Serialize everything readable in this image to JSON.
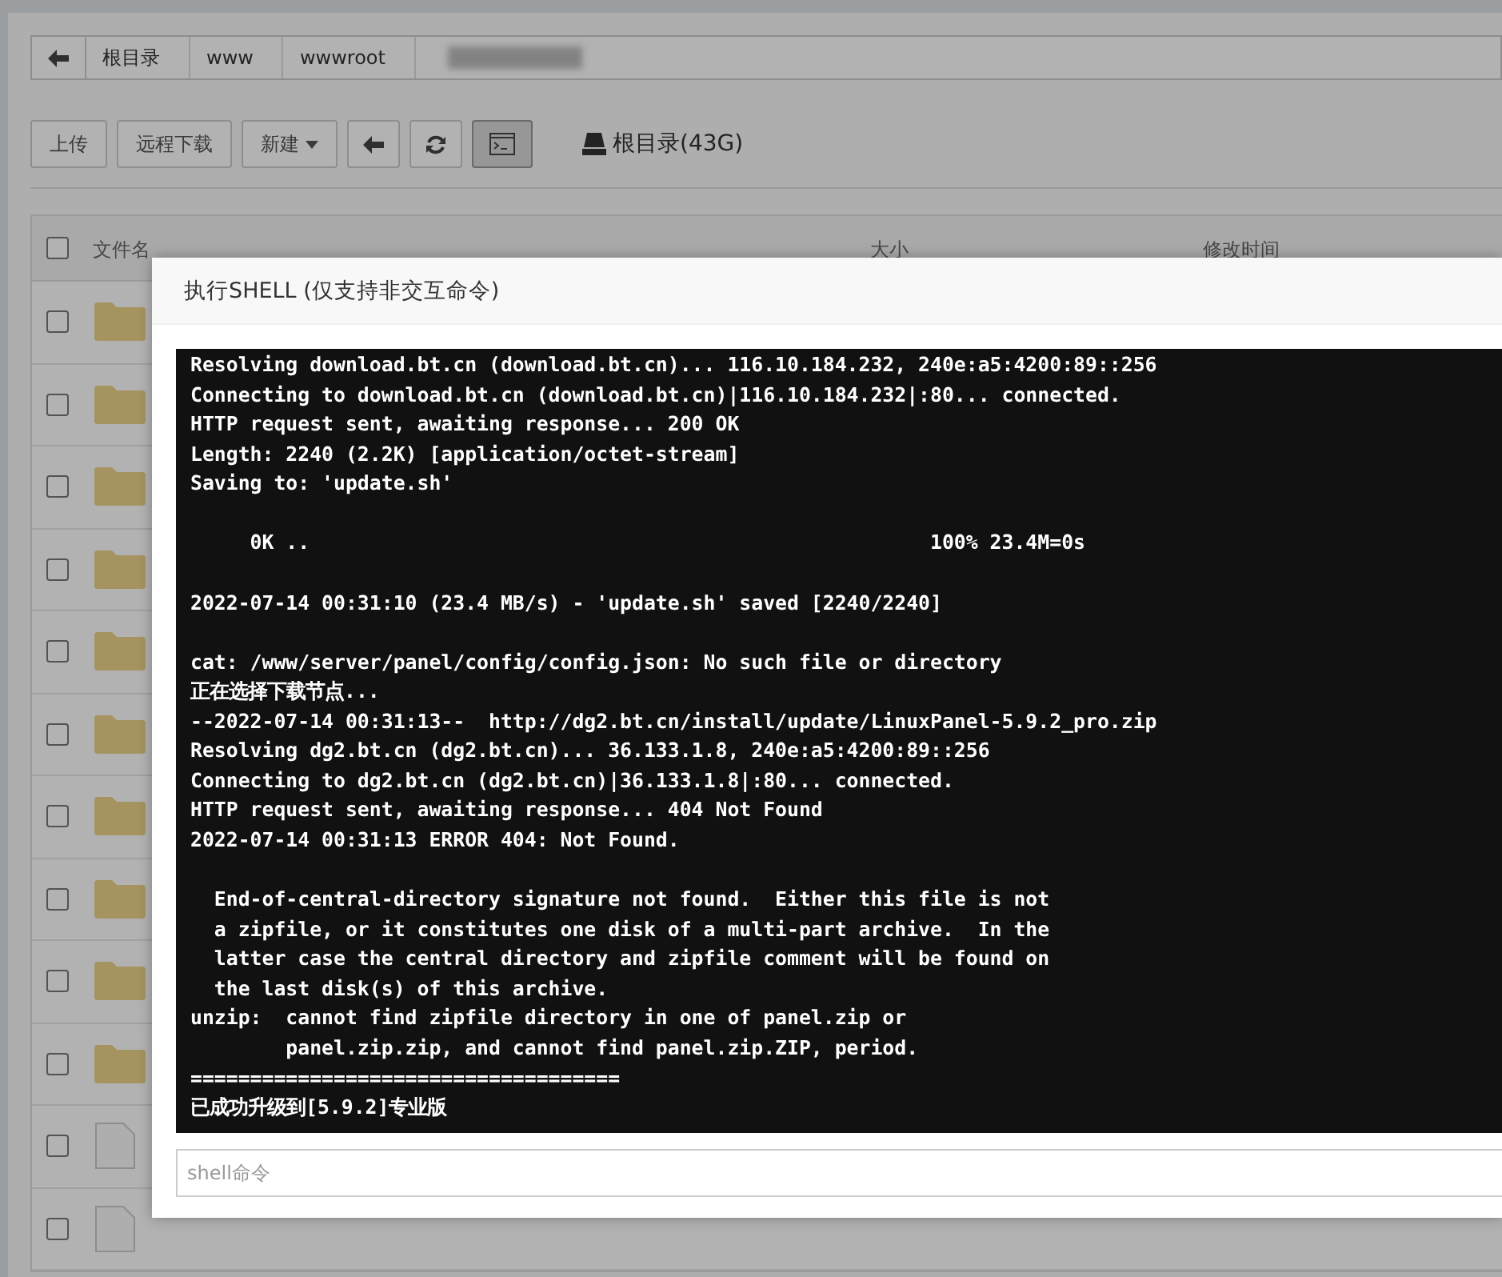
{
  "breadcrumbs": {
    "items": [
      "根目录",
      "www",
      "wwwroot"
    ],
    "has_redacted_item": true
  },
  "toolbar": {
    "buttons": [
      {
        "kind": "text",
        "label": "上传",
        "active": false
      },
      {
        "kind": "dropdown_none",
        "label": "远程下载",
        "active": false
      },
      {
        "kind": "dropdown",
        "label": "新建",
        "active": false
      },
      {
        "kind": "back",
        "active": false
      },
      {
        "kind": "refresh",
        "active": false
      },
      {
        "kind": "terminal",
        "active": true
      }
    ],
    "disk": "根目录(43G)"
  },
  "table": {
    "columns": [
      "文件名",
      "大小",
      "修改时间"
    ],
    "header_checked": false,
    "rows": [
      {
        "kind": "folder",
        "checked": false
      },
      {
        "kind": "folder",
        "checked": false
      },
      {
        "kind": "folder",
        "checked": false
      },
      {
        "kind": "folder",
        "checked": false
      },
      {
        "kind": "folder",
        "checked": false
      },
      {
        "kind": "folder",
        "checked": false
      },
      {
        "kind": "folder",
        "checked": false
      },
      {
        "kind": "folder",
        "checked": false
      },
      {
        "kind": "folder",
        "checked": false
      },
      {
        "kind": "folder",
        "checked": false
      },
      {
        "kind": "file",
        "checked": false
      },
      {
        "kind": "file",
        "checked": false
      }
    ]
  },
  "dialog": {
    "title": "执行SHELL (仅支持非交互命令)",
    "output": "Resolving download.bt.cn (download.bt.cn)... 116.10.184.232, 240e:a5:4200:89::256\nConnecting to download.bt.cn (download.bt.cn)|116.10.184.232|:80... connected.\nHTTP request sent, awaiting response... 200 OK\nLength: 2240 (2.2K) [application/octet-stream]\nSaving to: 'update.sh'\n\n     0K ..                                                    100% 23.4M=0s\n\n2022-07-14 00:31:10 (23.4 MB/s) - 'update.sh' saved [2240/2240]\n\ncat: /www/server/panel/config/config.json: No such file or directory\n正在选择下载节点...\n--2022-07-14 00:31:13--  http://dg2.bt.cn/install/update/LinuxPanel-5.9.2_pro.zip\nResolving dg2.bt.cn (dg2.bt.cn)... 36.133.1.8, 240e:a5:4200:89::256\nConnecting to dg2.bt.cn (dg2.bt.cn)|36.133.1.8|:80... connected.\nHTTP request sent, awaiting response... 404 Not Found\n2022-07-14 00:31:13 ERROR 404: Not Found.\n\n  End-of-central-directory signature not found.  Either this file is not\n  a zipfile, or it constitutes one disk of a multi-part archive.  In the\n  latter case the central directory and zipfile comment will be found on\n  the last disk(s) of this archive.\nunzip:  cannot find zipfile directory in one of panel.zip or\n        panel.zip.zip, and cannot find panel.zip.ZIP, period.\n====================================\n已成功升级到[5.9.2]专业版",
    "input": {
      "placeholder": "shell命令"
    }
  }
}
